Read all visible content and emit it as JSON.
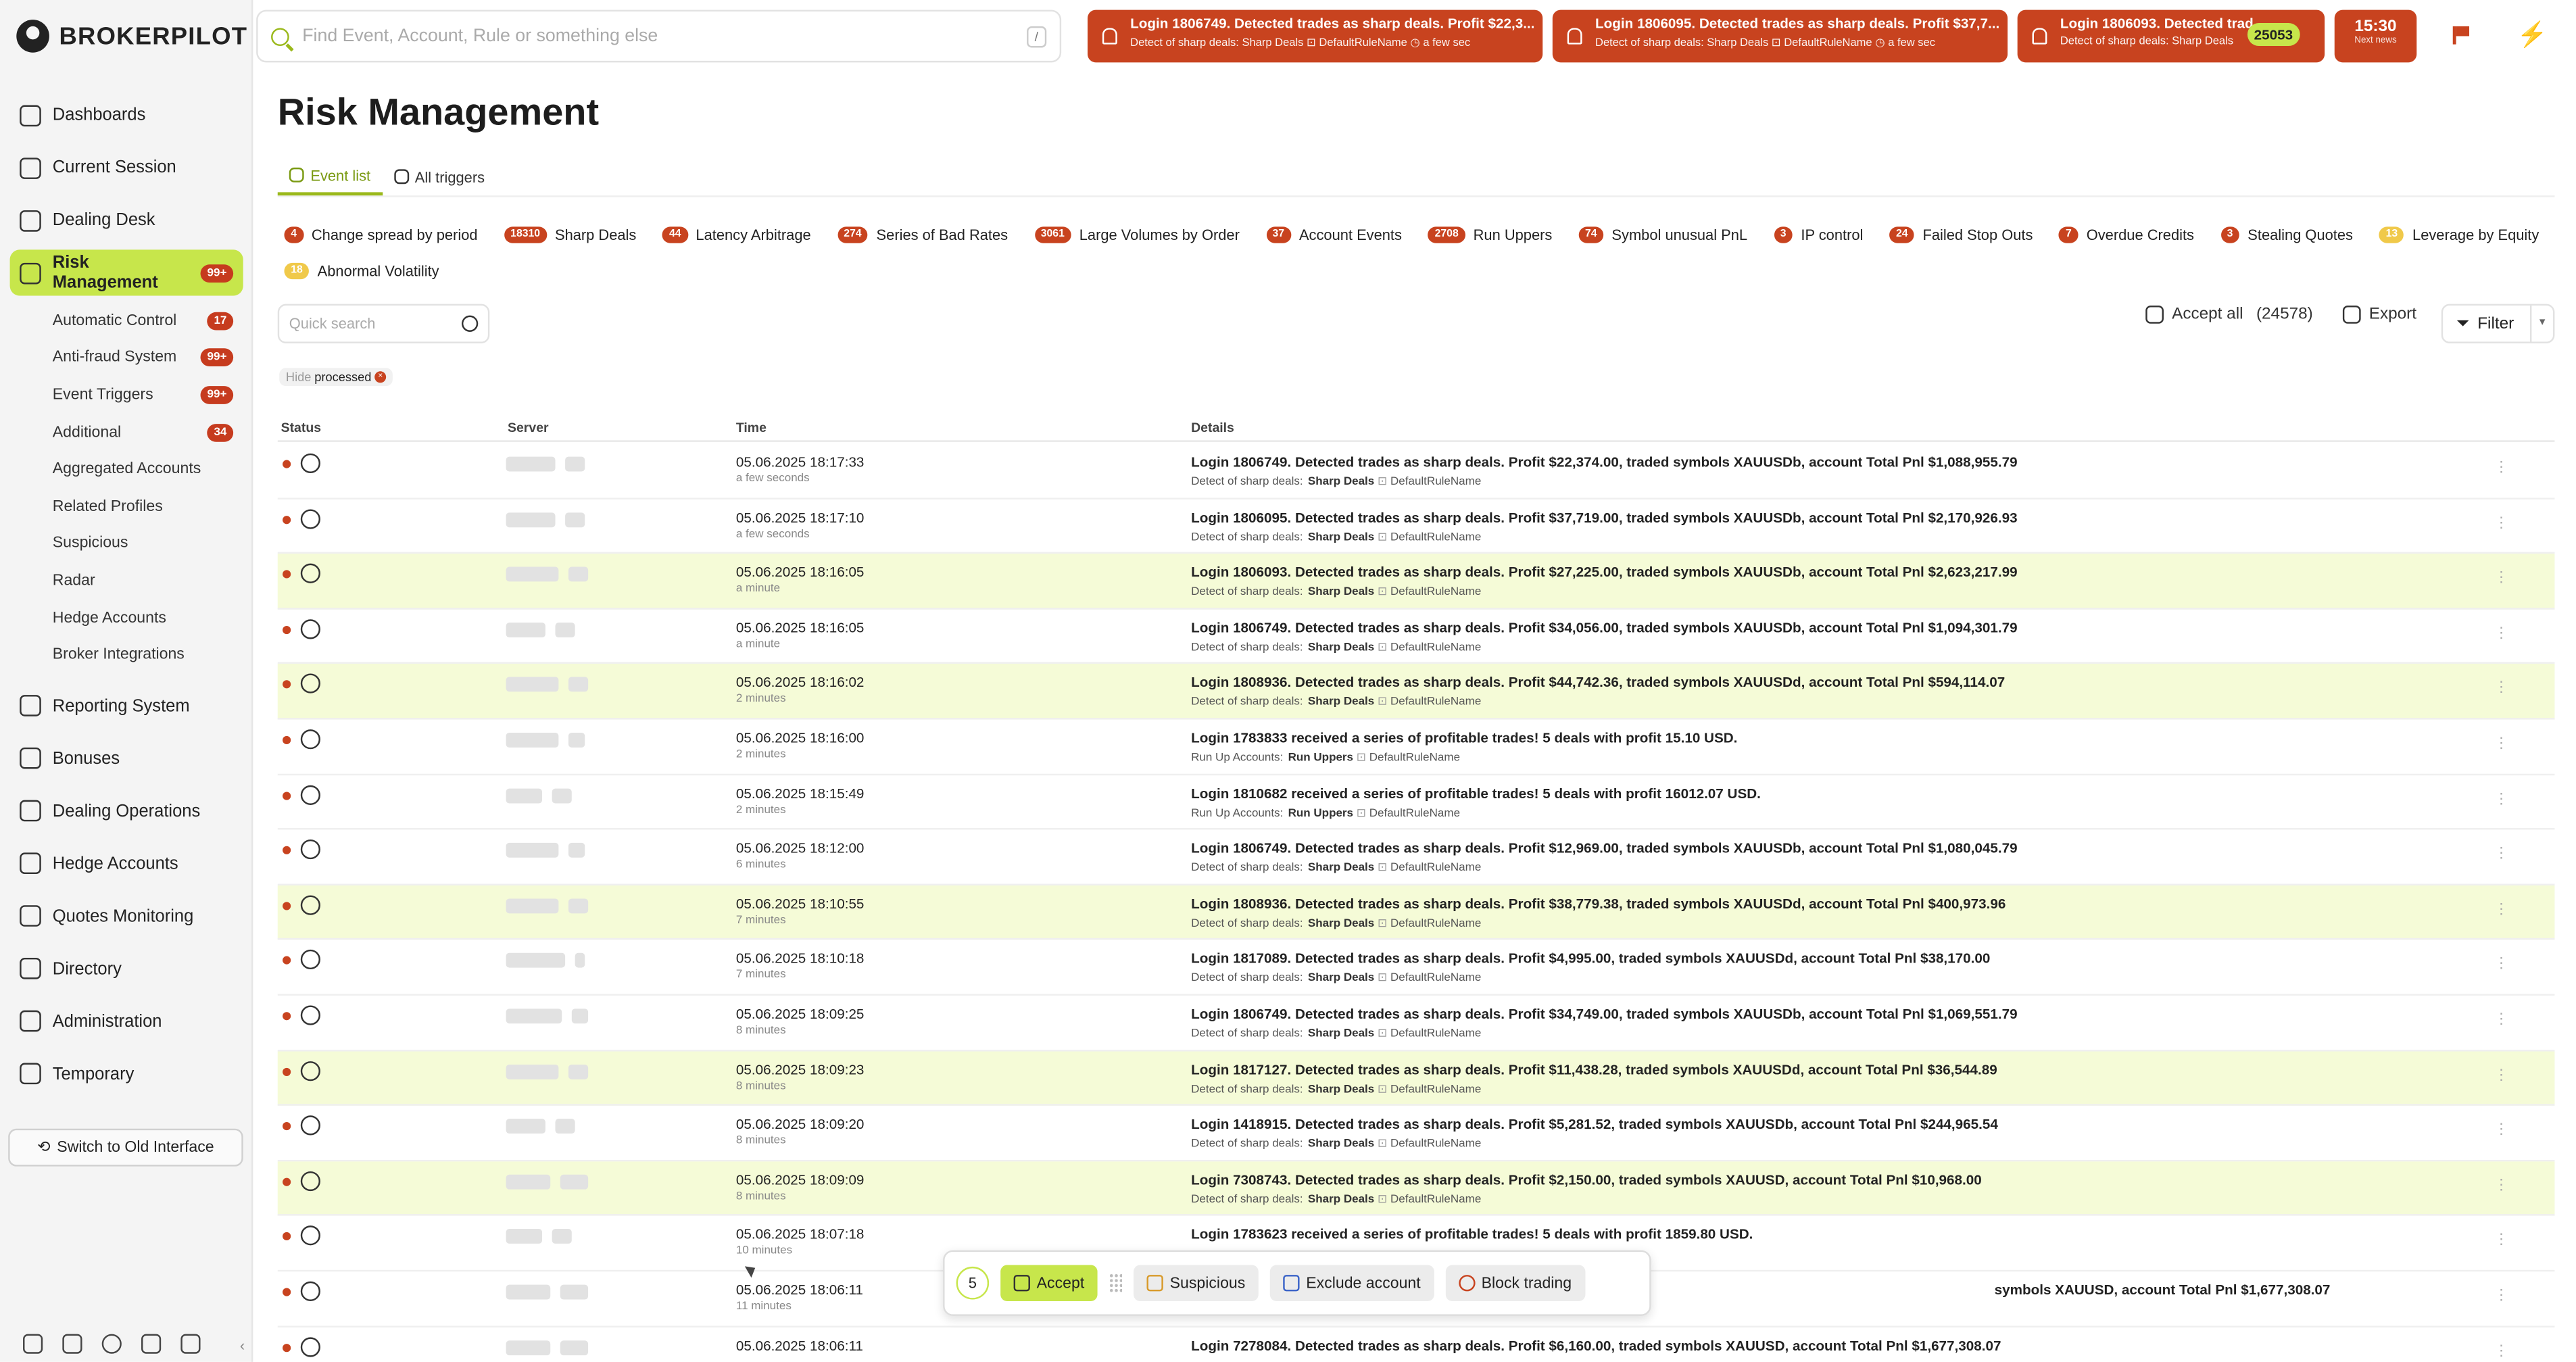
{
  "brand": {
    "name": "BROKERPILOT"
  },
  "search": {
    "placeholder": "Find Event, Account, Rule or something else",
    "shortcut": "/"
  },
  "alerts": [
    {
      "title": "Login 1806749. Detected trades as sharp deals. Profit $22,3...",
      "detail": "Detect of sharp deals: Sharp Deals  ⊡ DefaultRuleName  ◷ a few sec"
    },
    {
      "title": "Login 1806095. Detected trades as sharp deals. Profit $37,7...",
      "detail": "Detect of sharp deals: Sharp Deals  ⊡ DefaultRuleName  ◷ a few sec"
    },
    {
      "title": "Login 1806093. Detected trad",
      "detail": "Detect of sharp deals: Sharp Deals"
    }
  ],
  "alert_counter": "25053",
  "clock": {
    "time": "15:30",
    "label": "Next news"
  },
  "colors": {
    "accent": "#c7e64b",
    "alert": "#c8431f",
    "highlight": "#f5fbd7"
  },
  "sidebar": {
    "items_top": [
      {
        "label": "Dashboards",
        "icon": "dashboard-icon"
      },
      {
        "label": "Current Session",
        "icon": "session-icon"
      },
      {
        "label": "Dealing Desk",
        "icon": "desk-icon"
      }
    ],
    "active": {
      "label": "Risk Management",
      "badge": "99+",
      "icon": "risk-icon"
    },
    "subitems": [
      {
        "label": "Automatic Control",
        "badge": "17"
      },
      {
        "label": "Anti-fraud System",
        "badge": "99+"
      },
      {
        "label": "Event Triggers",
        "badge": "99+"
      },
      {
        "label": "Additional",
        "badge": "34"
      },
      {
        "label": "Aggregated Accounts",
        "badge": ""
      },
      {
        "label": "Related Profiles",
        "badge": ""
      },
      {
        "label": "Suspicious",
        "badge": ""
      },
      {
        "label": "Radar",
        "badge": ""
      },
      {
        "label": "Hedge Accounts",
        "badge": ""
      },
      {
        "label": "Broker Integrations",
        "badge": ""
      }
    ],
    "items_bottom": [
      {
        "label": "Reporting System",
        "icon": "report-icon"
      },
      {
        "label": "Bonuses",
        "icon": "bonus-icon"
      },
      {
        "label": "Dealing Operations",
        "icon": "operations-icon"
      },
      {
        "label": "Hedge Accounts",
        "icon": "hedge-icon"
      },
      {
        "label": "Quotes Monitoring",
        "icon": "quotes-icon"
      },
      {
        "label": "Directory",
        "icon": "directory-icon"
      },
      {
        "label": "Administration",
        "icon": "admin-icon"
      },
      {
        "label": "Temporary",
        "icon": "temporary-icon"
      }
    ],
    "switch_label": "Switch to Old Interface"
  },
  "page": {
    "title": "Risk Management",
    "tabs": [
      "Event list",
      "All triggers"
    ],
    "chips": [
      {
        "count": "4",
        "label": "Change spread by period",
        "tone": "r"
      },
      {
        "count": "18310",
        "label": "Sharp Deals",
        "tone": "r"
      },
      {
        "count": "44",
        "label": "Latency Arbitrage",
        "tone": "r"
      },
      {
        "count": "274",
        "label": "Series of Bad Rates",
        "tone": "r"
      },
      {
        "count": "3061",
        "label": "Large Volumes by Order",
        "tone": "r"
      },
      {
        "count": "37",
        "label": "Account Events",
        "tone": "r"
      },
      {
        "count": "2708",
        "label": "Run Uppers",
        "tone": "r"
      },
      {
        "count": "74",
        "label": "Symbol unusual PnL",
        "tone": "r"
      },
      {
        "count": "3",
        "label": "IP control",
        "tone": "r"
      },
      {
        "count": "24",
        "label": "Failed Stop Outs",
        "tone": "r"
      },
      {
        "count": "7",
        "label": "Overdue Credits",
        "tone": "r"
      },
      {
        "count": "3",
        "label": "Stealing Quotes",
        "tone": "r"
      },
      {
        "count": "13",
        "label": "Leverage by Equity",
        "tone": "y"
      },
      {
        "count": "18",
        "label": "Abnormal Volatility",
        "tone": "y"
      }
    ],
    "quick_search_placeholder": "Quick search",
    "hide_tag": {
      "prefix": "Hide",
      "value": "processed"
    },
    "accept_all": "Accept all",
    "accept_all_count": "(24578)",
    "export": "Export",
    "filter": "Filter"
  },
  "table": {
    "columns": [
      "Status",
      "Server",
      "Time",
      "Details"
    ],
    "rows": [
      {
        "time": "05.06.2025 18:17:33",
        "ago": "a few seconds",
        "details": "Login 1806749. Detected trades as sharp deals. Profit $22,374.00, traded symbols XAUUSDb, account Total Pnl $1,088,955.79",
        "sub_prefix": "Detect of sharp deals:",
        "sub_type": "Sharp Deals",
        "rule": "DefaultRuleName",
        "hl": false
      },
      {
        "time": "05.06.2025 18:17:10",
        "ago": "a few seconds",
        "details": "Login 1806095. Detected trades as sharp deals. Profit $37,719.00, traded symbols XAUUSDb, account Total Pnl $2,170,926.93",
        "sub_prefix": "Detect of sharp deals:",
        "sub_type": "Sharp Deals",
        "rule": "DefaultRuleName",
        "hl": false
      },
      {
        "time": "05.06.2025 18:16:05",
        "ago": "a minute",
        "details": "Login 1806093. Detected trades as sharp deals. Profit $27,225.00, traded symbols XAUUSDb, account Total Pnl $2,623,217.99",
        "sub_prefix": "Detect of sharp deals:",
        "sub_type": "Sharp Deals",
        "rule": "DefaultRuleName",
        "hl": true
      },
      {
        "time": "05.06.2025 18:16:05",
        "ago": "a minute",
        "details": "Login 1806749. Detected trades as sharp deals. Profit $34,056.00, traded symbols XAUUSDb, account Total Pnl $1,094,301.79",
        "sub_prefix": "Detect of sharp deals:",
        "sub_type": "Sharp Deals",
        "rule": "DefaultRuleName",
        "hl": false
      },
      {
        "time": "05.06.2025 18:16:02",
        "ago": "2 minutes",
        "details": "Login 1808936. Detected trades as sharp deals. Profit $44,742.36, traded symbols XAUUSDd, account Total Pnl $594,114.07",
        "sub_prefix": "Detect of sharp deals:",
        "sub_type": "Sharp Deals",
        "rule": "DefaultRuleName",
        "hl": true
      },
      {
        "time": "05.06.2025 18:16:00",
        "ago": "2 minutes",
        "details": "Login 1783833 received a series of profitable trades! 5 deals with profit 15.10 USD.",
        "sub_prefix": "Run Up Accounts:",
        "sub_type": "Run Uppers",
        "rule": "DefaultRuleName",
        "hl": false
      },
      {
        "time": "05.06.2025 18:15:49",
        "ago": "2 minutes",
        "details": "Login 1810682 received a series of profitable trades! 5 deals with profit 16012.07 USD.",
        "sub_prefix": "Run Up Accounts:",
        "sub_type": "Run Uppers",
        "rule": "DefaultRuleName",
        "hl": false
      },
      {
        "time": "05.06.2025 18:12:00",
        "ago": "6 minutes",
        "details": "Login 1806749. Detected trades as sharp deals. Profit $12,969.00, traded symbols XAUUSDb, account Total Pnl $1,080,045.79",
        "sub_prefix": "Detect of sharp deals:",
        "sub_type": "Sharp Deals",
        "rule": "DefaultRuleName",
        "hl": false
      },
      {
        "time": "05.06.2025 18:10:55",
        "ago": "7 minutes",
        "details": "Login 1808936. Detected trades as sharp deals. Profit $38,779.38, traded symbols XAUUSDd, account Total Pnl $400,973.96",
        "sub_prefix": "Detect of sharp deals:",
        "sub_type": "Sharp Deals",
        "rule": "DefaultRuleName",
        "hl": true
      },
      {
        "time": "05.06.2025 18:10:18",
        "ago": "7 minutes",
        "details": "Login 1817089. Detected trades as sharp deals. Profit $4,995.00, traded symbols XAUUSDd, account Total Pnl $38,170.00",
        "sub_prefix": "Detect of sharp deals:",
        "sub_type": "Sharp Deals",
        "rule": "DefaultRuleName",
        "hl": false
      },
      {
        "time": "05.06.2025 18:09:25",
        "ago": "8 minutes",
        "details": "Login 1806749. Detected trades as sharp deals. Profit $34,749.00, traded symbols XAUUSDb, account Total Pnl $1,069,551.79",
        "sub_prefix": "Detect of sharp deals:",
        "sub_type": "Sharp Deals",
        "rule": "DefaultRuleName",
        "hl": false
      },
      {
        "time": "05.06.2025 18:09:23",
        "ago": "8 minutes",
        "details": "Login 1817127. Detected trades as sharp deals. Profit $11,438.28, traded symbols XAUUSDd, account Total Pnl $36,544.89",
        "sub_prefix": "Detect of sharp deals:",
        "sub_type": "Sharp Deals",
        "rule": "DefaultRuleName",
        "hl": true
      },
      {
        "time": "05.06.2025 18:09:20",
        "ago": "8 minutes",
        "details": "Login 1418915. Detected trades as sharp deals. Profit $5,281.52, traded symbols XAUUSDb, account Total Pnl $244,965.54",
        "sub_prefix": "Detect of sharp deals:",
        "sub_type": "Sharp Deals",
        "rule": "DefaultRuleName",
        "hl": false
      },
      {
        "time": "05.06.2025 18:09:09",
        "ago": "8 minutes",
        "details": "Login 7308743. Detected trades as sharp deals. Profit $2,150.00, traded symbols XAUUSD, account Total Pnl $10,968.00",
        "sub_prefix": "Detect of sharp deals:",
        "sub_type": "Sharp Deals",
        "rule": "DefaultRuleName",
        "hl": true
      },
      {
        "time": "05.06.2025 18:07:18",
        "ago": "10 minutes",
        "details": "Login 1783623 received a series of profitable trades! 5 deals with profit 1859.80 USD.",
        "sub_prefix": "",
        "sub_type": "",
        "rule": "",
        "hl": false
      },
      {
        "time": "05.06.2025 18:06:11",
        "ago": "11 minutes",
        "details": "symbols XAUUSD, account Total Pnl $1,677,308.07",
        "sub_prefix": "",
        "sub_type": "",
        "rule": "",
        "hl": false,
        "offset": true
      },
      {
        "time": "05.06.2025 18:06:11",
        "ago": "",
        "details": "Login 7278084. Detected trades as sharp deals. Profit $6,160.00, traded symbols XAUUSD, account Total Pnl $1,677,308.07",
        "sub_prefix": "",
        "sub_type": "",
        "rule": "",
        "hl": false
      }
    ]
  },
  "actionbar": {
    "count": "5",
    "accept": "Accept",
    "suspicious": "Suspicious",
    "exclude": "Exclude account",
    "block": "Block trading"
  }
}
